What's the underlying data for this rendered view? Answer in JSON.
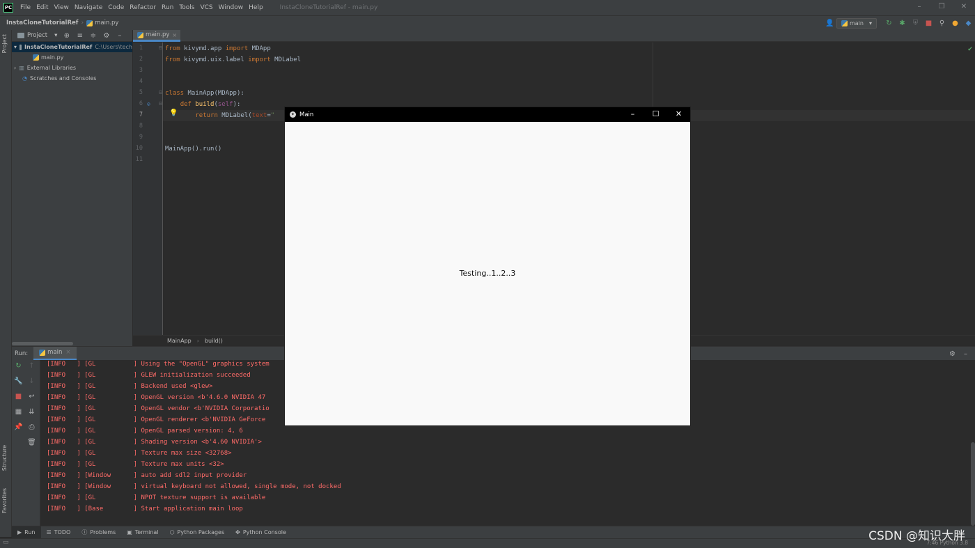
{
  "menubar": {
    "logo": "PC",
    "items": [
      "File",
      "Edit",
      "View",
      "Navigate",
      "Code",
      "Refactor",
      "Run",
      "Tools",
      "VCS",
      "Window",
      "Help"
    ],
    "window_title": "InstaCloneTutorialRef - main.py",
    "controls": [
      "–",
      "❐",
      "✕"
    ]
  },
  "navbar": {
    "project": "InstaCloneTutorialRef",
    "file": "main.py",
    "run_config": "main"
  },
  "left_stripe": {
    "project_tab": "Project",
    "structure_tab": "Structure",
    "favorites_tab": "Favorites"
  },
  "project_panel": {
    "dropdown": "Project",
    "root": "InstaCloneTutorialRef",
    "root_path": "C:\\Users\\tech",
    "file": "main.py",
    "external": "External Libraries",
    "scratches": "Scratches and Consoles"
  },
  "editor": {
    "tab": "main.py",
    "line_numbers": [
      "1",
      "2",
      "3",
      "4",
      "5",
      "6",
      "7",
      "8",
      "9",
      "10",
      "11"
    ],
    "line1": {
      "kw1": "from",
      "mod": " kivymd.app ",
      "kw2": "import",
      "name": " MDApp"
    },
    "line2": {
      "kw1": "from",
      "mod": " kivymd.uix.label ",
      "kw2": "import",
      "name": " MDLabel"
    },
    "line5": {
      "kw": "class",
      "rest": " MainApp(MDApp):"
    },
    "line6": {
      "indent": "    ",
      "kw": "def",
      "fn": "build",
      "open": "(",
      "self": "self",
      "close": "):"
    },
    "line7": {
      "indent": "        ",
      "kw": "return",
      "rest": " MDLabel(",
      "param": "text",
      "eq": "=",
      "str": "\""
    },
    "line10": "MainApp().run()",
    "breadcrumb1": "MainApp",
    "breadcrumb2": "build()"
  },
  "run": {
    "label": "Run:",
    "tab": "main",
    "log": [
      {
        "level": "[INFO   ]",
        "cat": "[GL          ]",
        "msg": "Using the \"OpenGL\" graphics system"
      },
      {
        "level": "[INFO   ]",
        "cat": "[GL          ]",
        "msg": "GLEW initialization succeeded"
      },
      {
        "level": "[INFO   ]",
        "cat": "[GL          ]",
        "msg": "Backend used <glew>"
      },
      {
        "level": "[INFO   ]",
        "cat": "[GL          ]",
        "msg": "OpenGL version <b'4.6.0 NVIDIA 47"
      },
      {
        "level": "[INFO   ]",
        "cat": "[GL          ]",
        "msg": "OpenGL vendor <b'NVIDIA Corporatio"
      },
      {
        "level": "[INFO   ]",
        "cat": "[GL          ]",
        "msg": "OpenGL renderer <b'NVIDIA GeForce"
      },
      {
        "level": "[INFO   ]",
        "cat": "[GL          ]",
        "msg": "OpenGL parsed version: 4, 6"
      },
      {
        "level": "[INFO   ]",
        "cat": "[GL          ]",
        "msg": "Shading version <b'4.60 NVIDIA'>"
      },
      {
        "level": "[INFO   ]",
        "cat": "[GL          ]",
        "msg": "Texture max size <32768>"
      },
      {
        "level": "[INFO   ]",
        "cat": "[GL          ]",
        "msg": "Texture max units <32>"
      },
      {
        "level": "[INFO   ]",
        "cat": "[Window      ]",
        "msg": "auto add sdl2 input provider"
      },
      {
        "level": "[INFO   ]",
        "cat": "[Window      ]",
        "msg": "virtual keyboard not allowed, single mode, not docked"
      },
      {
        "level": "[INFO   ]",
        "cat": "[GL          ]",
        "msg": "NPOT texture support is available"
      },
      {
        "level": "[INFO   ]",
        "cat": "[Base        ]",
        "msg": "Start application main loop"
      }
    ]
  },
  "bottom_tabs": [
    "Run",
    "TODO",
    "Problems",
    "Terminal",
    "Python Packages",
    "Python Console"
  ],
  "status": {
    "right": "7:46   Python 3.8"
  },
  "watermark": "CSDN @知识大胖",
  "kivy": {
    "title": "Main",
    "label": "Testing..1..2..3",
    "controls": [
      "–",
      "☐",
      "✕"
    ]
  },
  "colors": {
    "accent": "#4a88c7",
    "log_red": "#ff6b68",
    "keyword": "#cc7832",
    "function": "#ffc66d"
  }
}
